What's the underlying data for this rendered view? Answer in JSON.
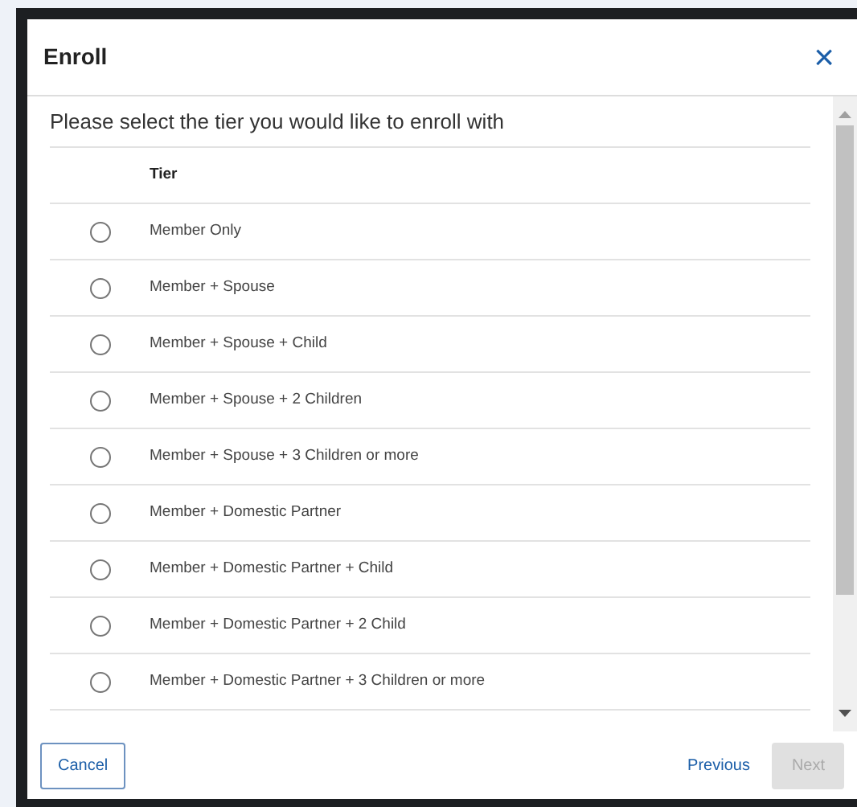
{
  "dialog": {
    "title": "Enroll",
    "close_glyph": "×"
  },
  "prompt": "Please select the tier you would like to enroll with",
  "table": {
    "columns": [
      "Tier"
    ],
    "rows": [
      {
        "tier": "Member Only",
        "selected": false
      },
      {
        "tier": "Member + Spouse",
        "selected": false
      },
      {
        "tier": "Member + Spouse + Child",
        "selected": false
      },
      {
        "tier": "Member + Spouse + 2 Children",
        "selected": false
      },
      {
        "tier": "Member + Spouse + 3 Children or more",
        "selected": false
      },
      {
        "tier": "Member + Domestic Partner",
        "selected": false
      },
      {
        "tier": "Member + Domestic Partner + Child",
        "selected": false
      },
      {
        "tier": "Member + Domestic Partner + 2 Child",
        "selected": false
      },
      {
        "tier": "Member + Domestic Partner + 3 Children or more",
        "selected": false
      }
    ]
  },
  "footer": {
    "buttons": [
      {
        "label": "Cancel",
        "kind": "outline",
        "disabled": false
      },
      {
        "label": "Previous",
        "kind": "link",
        "disabled": false
      },
      {
        "label": "Next",
        "kind": "primary",
        "disabled": true
      }
    ]
  }
}
